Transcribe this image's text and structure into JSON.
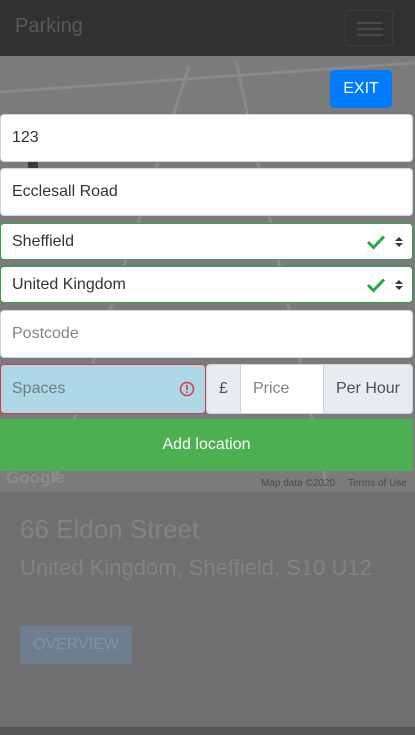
{
  "navbar": {
    "brand": "Parking"
  },
  "map": {
    "attribution": "Map data ©2020",
    "terms": "Terms of Use",
    "logo": "Google"
  },
  "exit_label": "EXIT",
  "form": {
    "number": {
      "value": "123"
    },
    "street": {
      "value": "Ecclesall Road"
    },
    "city": {
      "value": "Sheffield"
    },
    "country": {
      "value": "United Kingdom"
    },
    "postcode": {
      "placeholder": "Postcode"
    },
    "spaces": {
      "placeholder": "Spaces"
    },
    "price": {
      "currency": "£",
      "placeholder": "Price",
      "unit": "Per Hour"
    },
    "submit_label": "Add location"
  },
  "location_card": {
    "title": "66 Eldon Street",
    "subtitle": "United Kingdom, Sheffield, S10 U12",
    "overview_label": "OVERVIEW"
  },
  "colors": {
    "primary": "#007bff",
    "success": "#28a745",
    "danger": "#dc3545",
    "add_button": "#4caf50",
    "spaces_bg": "#add8e6"
  }
}
